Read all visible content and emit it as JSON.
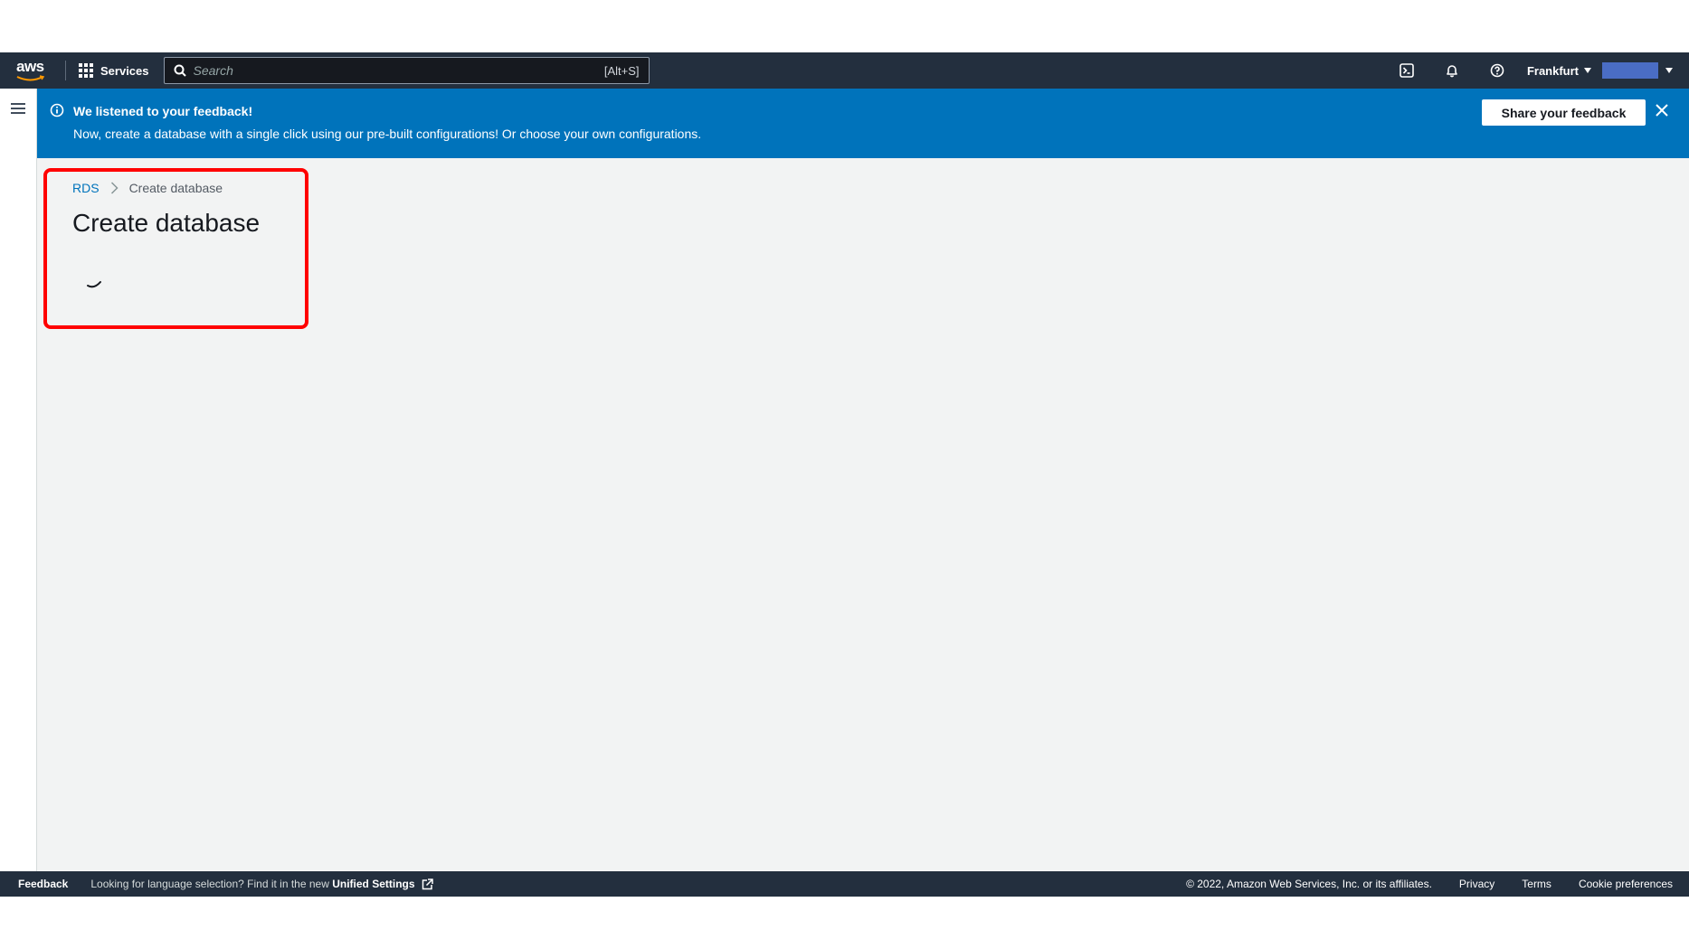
{
  "topbar": {
    "logo_text": "aws",
    "services_label": "Services",
    "search_placeholder": "Search",
    "search_shortcut": "[Alt+S]",
    "region": "Frankfurt",
    "icons": [
      "cloudshell-icon",
      "bell-icon",
      "help-icon"
    ]
  },
  "banner": {
    "title": "We listened to your feedback!",
    "message": "Now, create a database with a single click using our pre-built configurations! Or choose your own configurations.",
    "share_button": "Share your feedback",
    "color": "#0073bb"
  },
  "breadcrumb": {
    "root": "RDS",
    "current": "Create database"
  },
  "page": {
    "title": "Create database",
    "loading": true
  },
  "footer": {
    "feedback": "Feedback",
    "lang_text": "Looking for language selection? Find it in the new",
    "unified_settings": "Unified Settings",
    "copyright": "© 2022, Amazon Web Services, Inc. or its affiliates.",
    "privacy": "Privacy",
    "terms": "Terms",
    "cookie": "Cookie preferences"
  },
  "colors": {
    "topbar": "#232f3e",
    "content_bg": "#f2f3f3",
    "link": "#0073bb",
    "highlight": "#ff0000"
  }
}
